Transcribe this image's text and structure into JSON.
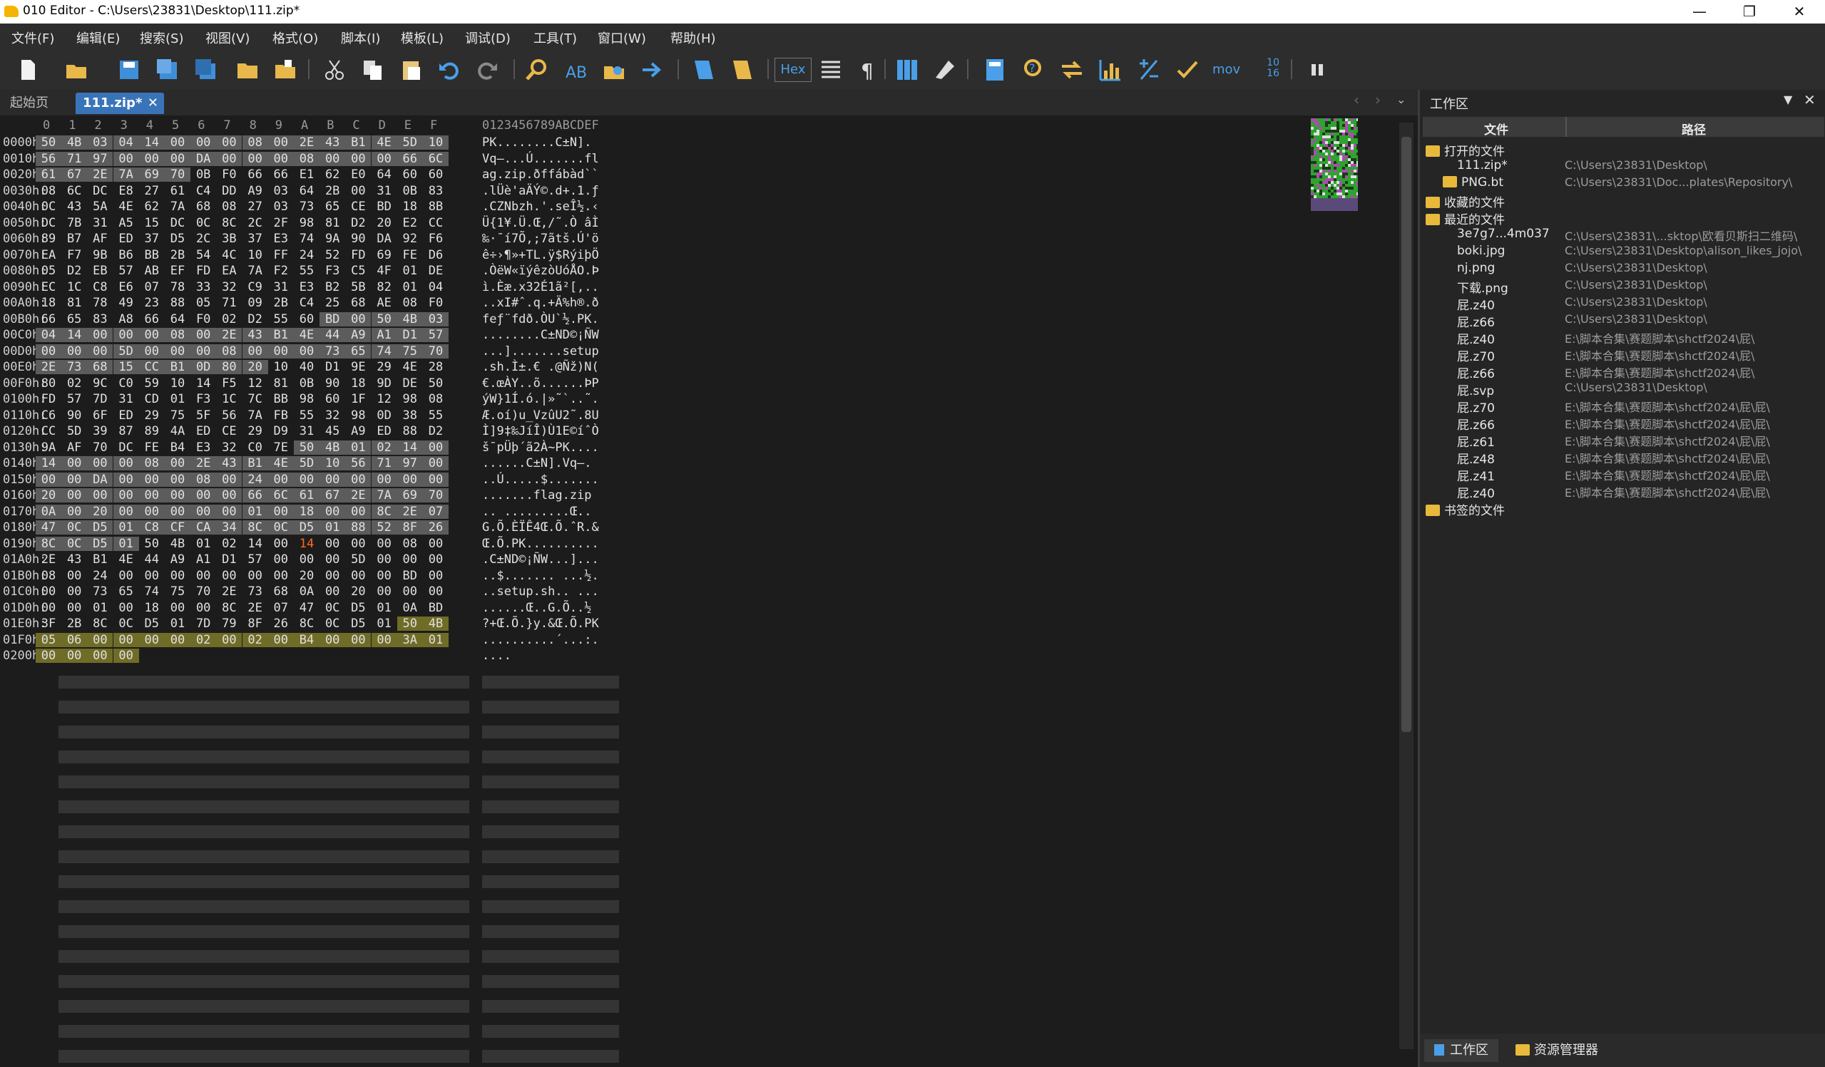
{
  "window": {
    "title": "010 Editor - C:\\Users\\23831\\Desktop\\111.zip*"
  },
  "menu": [
    "文件(F)",
    "编辑(E)",
    "搜索(S)",
    "视图(V)",
    "格式(O)",
    "脚本(I)",
    "模板(L)",
    "调试(D)",
    "工具(T)",
    "窗口(W)",
    "帮助(H)"
  ],
  "toolbar": {
    "hex_label": "Hex",
    "mov_label": "mov",
    "base_top": "10",
    "base_bottom": "16"
  },
  "tabs": {
    "start": "起始页",
    "file": "111.zip*"
  },
  "editor": {
    "col_headers": [
      "0",
      "1",
      "2",
      "3",
      "4",
      "5",
      "6",
      "7",
      "8",
      "9",
      "A",
      "B",
      "C",
      "D",
      "E",
      "F"
    ],
    "ascii_header": "0123456789ABCDEF",
    "rows": [
      {
        "addr": "0000h:",
        "hex": "50 4B 03 04 14 00 00 00 08 00 2E 43 B1 4E 5D 10",
        "ascii": "PK........C±N]."
      },
      {
        "addr": "0010h:",
        "hex": "56 71 97 00 00 00 DA 00 00 00 08 00 00 00 66 6C",
        "ascii": "Vq—...Ú.......fl"
      },
      {
        "addr": "0020h:",
        "hex": "61 67 2E 7A 69 70 0B F0 66 66 E1 62 E0 64 60 60",
        "ascii": "ag.zip.ðffábàd``"
      },
      {
        "addr": "0030h:",
        "hex": "08 6C DC E8 27 61 C4 DD A9 03 64 2B 00 31 0B 83",
        "ascii": ".lÜè'aÄÝ©.d+.1.ƒ"
      },
      {
        "addr": "0040h:",
        "hex": "0C 43 5A 4E 62 7A 68 08 27 03 73 65 CE BD 18 8B",
        "ascii": ".CZNbzh.'.seÎ½.‹"
      },
      {
        "addr": "0050h:",
        "hex": "DC 7B 31 A5 15 DC 0C 8C 2C 2F 98 81 D2 20 E2 CC",
        "ascii": "Ü{1¥.Ü.Œ,/˜.Ò âÌ"
      },
      {
        "addr": "0060h:",
        "hex": "89 B7 AF ED 37 D5 2C 3B 37 E3 74 9A 90 DA 92 F6",
        "ascii": "‰·¯í7Õ,;7ãtš.Ú'ö"
      },
      {
        "addr": "0070h:",
        "hex": "EA F7 9B B6 BB 2B 54 4C 10 FF 24 52 FD 69 FE D6",
        "ascii": "ê÷›¶»+TL.ÿ$RýiþÖ"
      },
      {
        "addr": "0080h:",
        "hex": "05 D2 EB 57 AB EF FD EA 7A F2 55 F3 C5 4F 01 DE",
        "ascii": ".ÒëW«ïýêzòUóÅO.Þ"
      },
      {
        "addr": "0090h:",
        "hex": "EC 1C C8 E6 07 78 33 32 C9 31 E3 B2 5B 82 01 04",
        "ascii": "ì.Èæ.x32É1ã²[‚.."
      },
      {
        "addr": "00A0h:",
        "hex": "18 81 78 49 23 88 05 71 09 2B C4 25 68 AE 08 F0",
        "ascii": "..xI#ˆ.q.+Ä%h®.ð"
      },
      {
        "addr": "00B0h:",
        "hex": "66 65 83 A8 66 64 F0 02 D2 55 60 BD 00 50 4B 03",
        "ascii": "feƒ¨fdð.ÒU`½.PK."
      },
      {
        "addr": "00C0h:",
        "hex": "04 14 00 00 00 08 00 2E 43 B1 4E 44 A9 A1 D1 57",
        "ascii": "........C±ND©¡ÑW"
      },
      {
        "addr": "00D0h:",
        "hex": "00 00 00 5D 00 00 00 08 00 00 00 73 65 74 75 70",
        "ascii": "...].......setup"
      },
      {
        "addr": "00E0h:",
        "hex": "2E 73 68 15 CC B1 0D 80 20 10 40 D1 9E 29 4E 28",
        "ascii": ".sh.Ì±.€ .@Ñž)N("
      },
      {
        "addr": "00F0h:",
        "hex": "80 02 9C C0 59 10 14 F5 12 81 0B 90 18 9D DE 50",
        "ascii": "€.œÀY..õ......ÞP"
      },
      {
        "addr": "0100h:",
        "hex": "FD 57 7D 31 CD 01 F3 1C 7C BB 98 60 1F 12 98 08",
        "ascii": "ýW}1Í.ó.|»˜`..˜."
      },
      {
        "addr": "0110h:",
        "hex": "C6 90 6F ED 29 75 5F 56 7A FB 55 32 98 0D 38 55",
        "ascii": "Æ.oí)u_VzûU2˜.8U"
      },
      {
        "addr": "0120h:",
        "hex": "CC 5D 39 87 89 4A ED CE 29 D9 31 45 A9 ED 88 D2",
        "ascii": "Ì]9‡‰JíÎ)Ù1E©íˆÒ"
      },
      {
        "addr": "0130h:",
        "hex": "9A AF 70 DC FE B4 E3 32 C0 7E 50 4B 01 02 14 00",
        "ascii": "š¯pÜþ´ã2À~PK...."
      },
      {
        "addr": "0140h:",
        "hex": "14 00 00 00 08 00 2E 43 B1 4E 5D 10 56 71 97 00",
        "ascii": "......C±N].Vq—."
      },
      {
        "addr": "0150h:",
        "hex": "00 00 DA 00 00 00 08 00 24 00 00 00 00 00 00 00",
        "ascii": "..Ú.....$......."
      },
      {
        "addr": "0160h:",
        "hex": "20 00 00 00 00 00 00 00 66 6C 61 67 2E 7A 69 70",
        "ascii": " .......flag.zip"
      },
      {
        "addr": "0170h:",
        "hex": "0A 00 20 00 00 00 00 00 01 00 18 00 00 8C 2E 07",
        "ascii": ".. .........Œ.."
      },
      {
        "addr": "0180h:",
        "hex": "47 0C D5 01 C8 CF CA 34 8C 0C D5 01 88 52 8F 26",
        "ascii": "G.Õ.ÈÏÊ4Œ.Õ.ˆR.&"
      },
      {
        "addr": "0190h:",
        "hex": "8C 0C D5 01 50 4B 01 02 14 00 14 00 00 00 08 00",
        "ascii": "Œ.Õ.PK.........."
      },
      {
        "addr": "01A0h:",
        "hex": "2E 43 B1 4E 44 A9 A1 D1 57 00 00 00 5D 00 00 00",
        "ascii": ".C±ND©¡ÑW...]..."
      },
      {
        "addr": "01B0h:",
        "hex": "08 00 24 00 00 00 00 00 00 00 20 00 00 00 BD 00",
        "ascii": "..$....... ...½."
      },
      {
        "addr": "01C0h:",
        "hex": "00 00 73 65 74 75 70 2E 73 68 0A 00 20 00 00 00",
        "ascii": "..setup.sh.. ..."
      },
      {
        "addr": "01D0h:",
        "hex": "00 00 01 00 18 00 00 8C 2E 07 47 0C D5 01 0A BD",
        "ascii": "......Œ..G.Õ..½"
      },
      {
        "addr": "01E0h:",
        "hex": "3F 2B 8C 0C D5 01 7D 79 8F 26 8C 0C D5 01 50 4B",
        "ascii": "?+Œ.Õ.}y.&Œ.Õ.PK"
      },
      {
        "addr": "01F0h:",
        "hex": "05 06 00 00 00 00 02 00 02 00 B4 00 00 00 3A 01",
        "ascii": "..........´...:."
      },
      {
        "addr": "0200h:",
        "hex": "00 00 00 00",
        "ascii": "...."
      }
    ]
  },
  "panel": {
    "title": "工作区",
    "col_file": "文件",
    "col_path": "路径",
    "open_files": "打开的文件",
    "favorites": "收藏的文件",
    "recent": "最近的文件",
    "bookmarked": "书签的文件",
    "open_items": [
      {
        "name": "111.zip*",
        "path": "C:\\Users\\23831\\Desktop\\"
      },
      {
        "name": "PNG.bt",
        "path": "C:\\Users\\23831\\Doc...plates\\Repository\\"
      }
    ],
    "recent_items": [
      {
        "name": "3e7g7...4m037",
        "path": "C:\\Users\\23831\\...sktop\\欧看贝斯扫二维码\\"
      },
      {
        "name": "boki.jpg",
        "path": "C:\\Users\\23831\\Desktop\\alison_likes_jojo\\"
      },
      {
        "name": "nj.png",
        "path": "C:\\Users\\23831\\Desktop\\"
      },
      {
        "name": "下载.png",
        "path": "C:\\Users\\23831\\Desktop\\"
      },
      {
        "name": "屁.z40",
        "path": "C:\\Users\\23831\\Desktop\\"
      },
      {
        "name": "屁.z66",
        "path": "C:\\Users\\23831\\Desktop\\"
      },
      {
        "name": "屁.z40",
        "path": "E:\\脚本合集\\赛题脚本\\shctf2024\\屁\\"
      },
      {
        "name": "屁.z70",
        "path": "E:\\脚本合集\\赛题脚本\\shctf2024\\屁\\"
      },
      {
        "name": "屁.z66",
        "path": "E:\\脚本合集\\赛题脚本\\shctf2024\\屁\\"
      },
      {
        "name": "屁.svp",
        "path": "C:\\Users\\23831\\Desktop\\"
      },
      {
        "name": "屁.z70",
        "path": "E:\\脚本合集\\赛题脚本\\shctf2024\\屁\\屁\\"
      },
      {
        "name": "屁.z66",
        "path": "E:\\脚本合集\\赛题脚本\\shctf2024\\屁\\屁\\"
      },
      {
        "name": "屁.z61",
        "path": "E:\\脚本合集\\赛题脚本\\shctf2024\\屁\\屁\\"
      },
      {
        "name": "屁.z48",
        "path": "E:\\脚本合集\\赛题脚本\\shctf2024\\屁\\屁\\"
      },
      {
        "name": "屁.z41",
        "path": "E:\\脚本合集\\赛题脚本\\shctf2024\\屁\\屁\\"
      },
      {
        "name": "屁.z40",
        "path": "E:\\脚本合集\\赛题脚本\\shctf2024\\屁\\屁\\"
      }
    ],
    "tab_workspace": "工作区",
    "tab_explorer": "资源管理器"
  },
  "colors": {
    "hex_hl": "#5c5c5c",
    "hex_hl2": "#6f6c27",
    "orange": "#ff6a1a"
  }
}
